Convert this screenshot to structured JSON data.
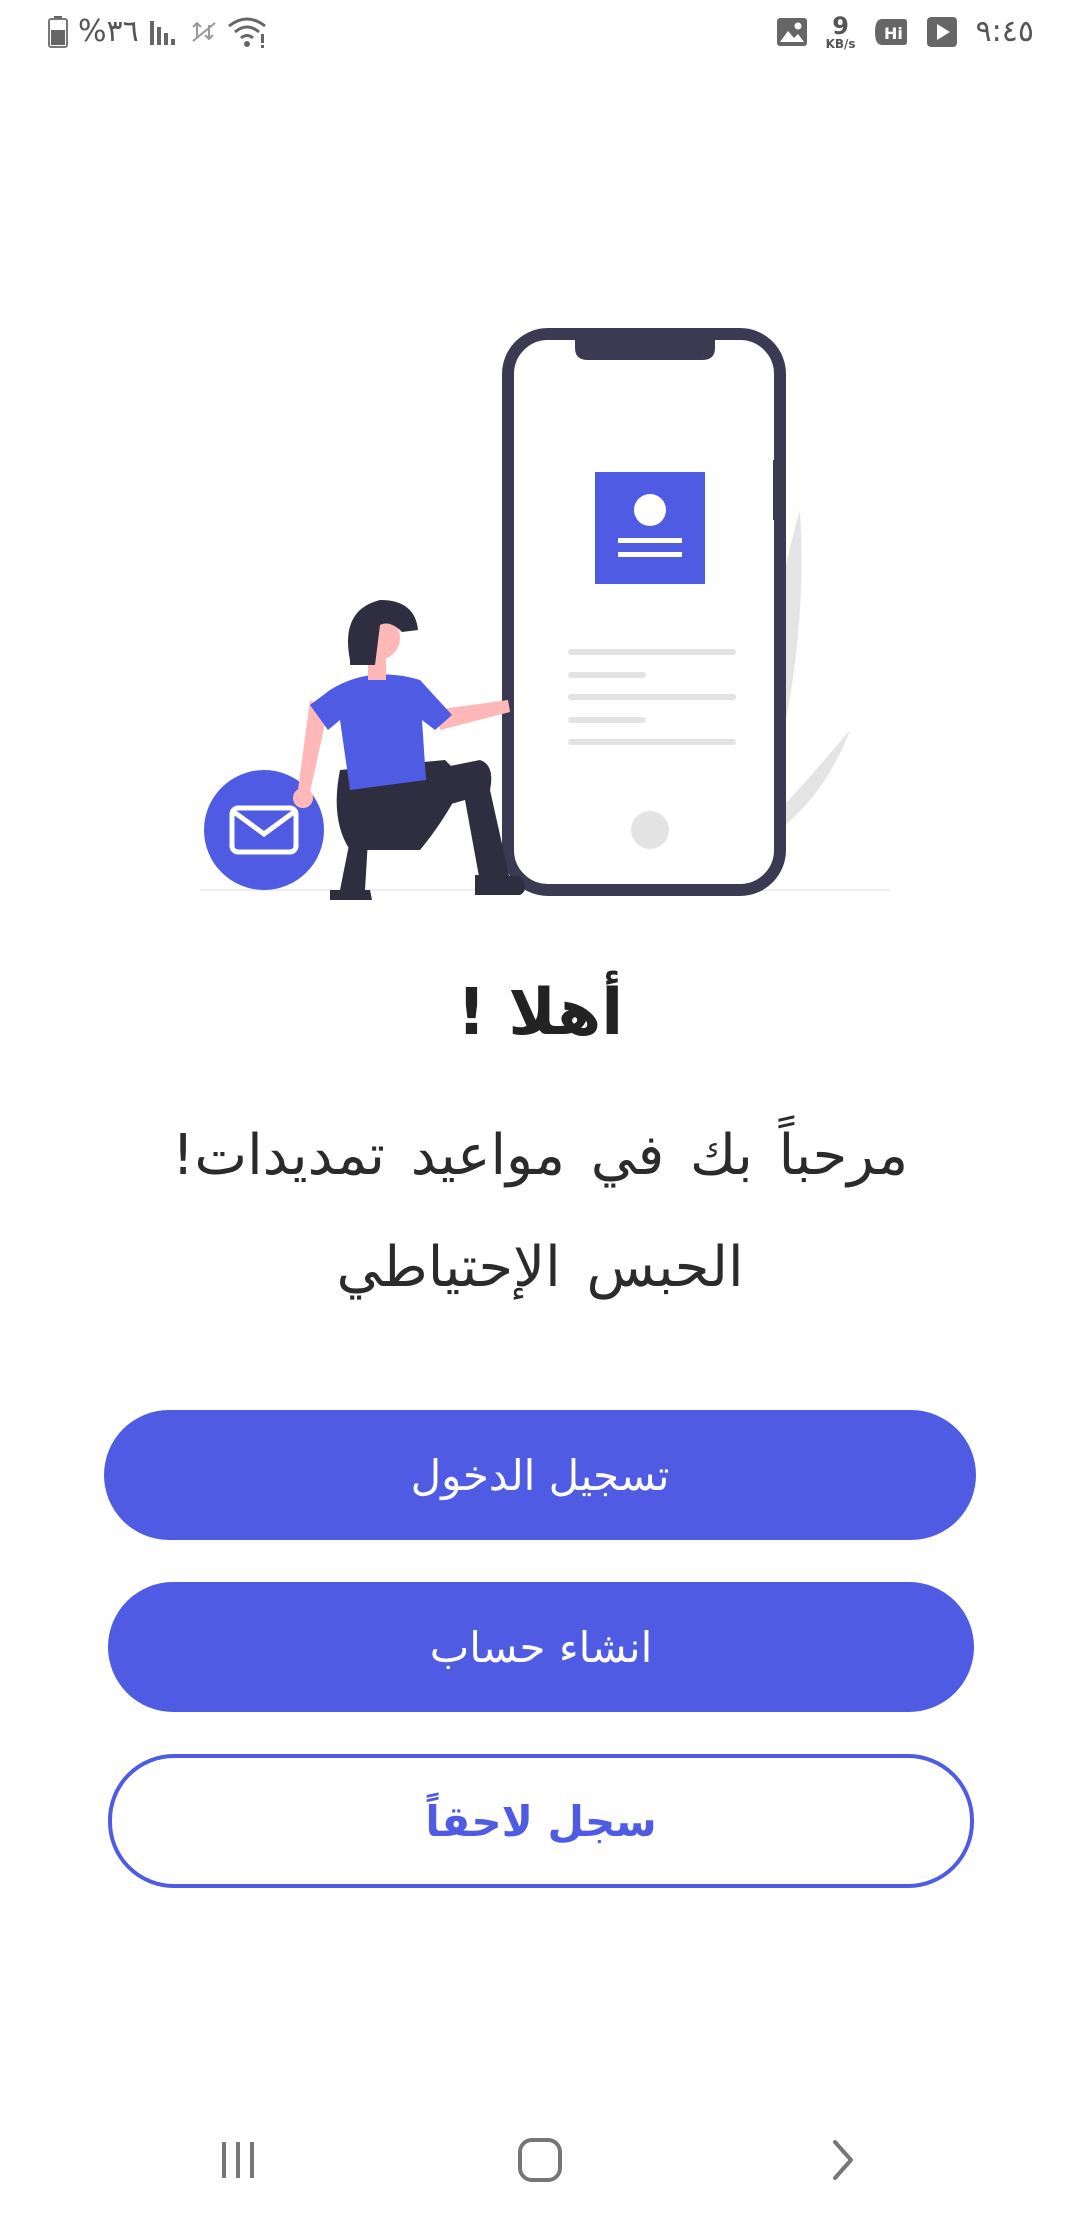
{
  "status_bar": {
    "battery_percent_text": "%٣٦",
    "network_speed_value": "9",
    "network_speed_unit": "KB/s",
    "time": "٩:٤٥",
    "icons": [
      "battery-icon",
      "signal-bars-icon",
      "data-off-icon",
      "wifi-icon",
      "image-notification-icon",
      "hd-voice-icon",
      "play-store-icon"
    ]
  },
  "illustration": {
    "description_icon": "phone-with-person-illustration",
    "accent_color": "#4f5be3"
  },
  "main": {
    "headline": "أهلا !",
    "welcome_line_1": "مرحباً بك في مواعيد تمديدات!",
    "welcome_line_2": "الحبس الإحتياطي"
  },
  "buttons": {
    "login_label": "تسجيل الدخول",
    "register_label": "انشاء حساب",
    "later_label": "سجل لاحقاً"
  },
  "nav_bar": {
    "icons": [
      "recent-apps-icon",
      "home-icon",
      "back-icon"
    ]
  },
  "colors": {
    "primary": "#4f5be3",
    "text": "#222222",
    "background": "#ffffff"
  }
}
